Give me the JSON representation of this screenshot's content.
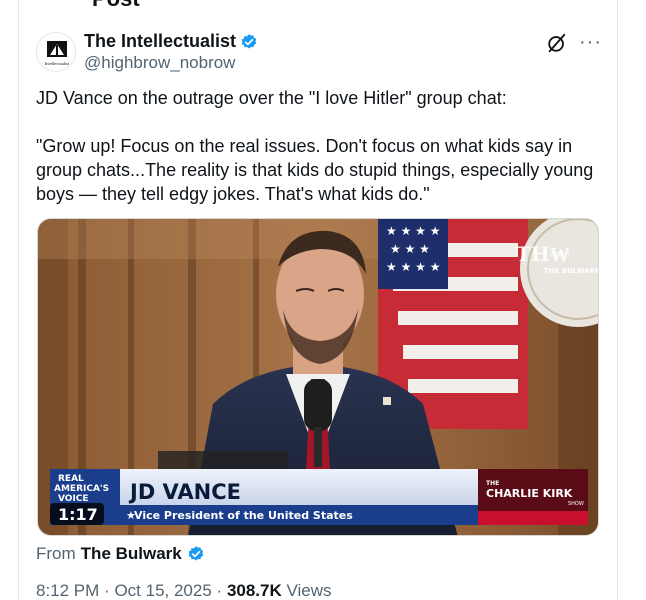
{
  "header_cutoff": "Post",
  "author": {
    "name": "The Intellectualist",
    "handle": "@highbrow_nobrow",
    "avatar_text": "Intellectualist"
  },
  "tweet": {
    "text": "JD Vance on the outrage over the \"I love Hitler\" group chat:\n\n\"Grow up! Focus on the real issues. Don't focus on what kids say in group chats...The reality is that kids do stupid things, especially young boys — they tell edgy jokes. That's what kids do.\""
  },
  "video": {
    "channel_line1": "REAL",
    "channel_line2": "AMERICA'S",
    "channel_line3": "VOICE",
    "duration": "1:17",
    "lower_third_name": "JD VANCE",
    "lower_third_title": "Vice President of the United States",
    "show_small": "THE",
    "show_name": "CHARLIE KIRK",
    "show_sub": "SHOW",
    "watermark": "THE BULWARK"
  },
  "source": {
    "prefix": "From",
    "name": "The Bulwark"
  },
  "meta": {
    "time": "8:12 PM",
    "date": "Oct 15, 2025",
    "views_count": "308.7K",
    "views_label": "Views",
    "separator": "·"
  },
  "colors": {
    "verified": "#1d9bf0",
    "secondary_text": "#536471",
    "lower_third_blue": "#1a3e8c",
    "show_red": "#c8102e"
  }
}
